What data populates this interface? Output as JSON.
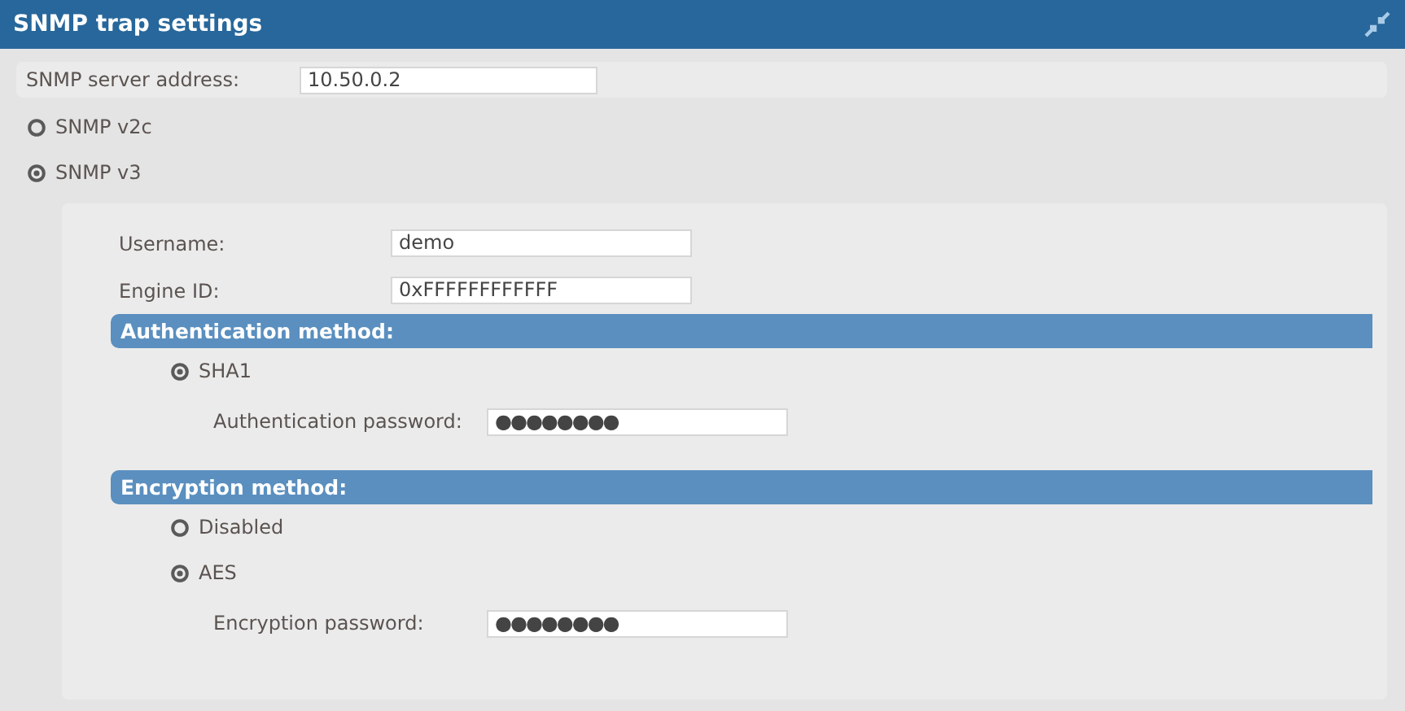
{
  "window": {
    "title": "SNMP trap settings"
  },
  "server": {
    "label": "SNMP server address:",
    "value": "10.50.0.2"
  },
  "versions": [
    {
      "label": "SNMP v2c",
      "selected": false
    },
    {
      "label": "SNMP v3",
      "selected": true
    }
  ],
  "v3": {
    "fields": [
      {
        "label": "Username:",
        "value": "demo"
      },
      {
        "label": "Engine ID:",
        "value": "0xFFFFFFFFFFFF"
      }
    ],
    "sections": [
      {
        "title": "Authentication method:",
        "options": [
          {
            "label": "SHA1",
            "selected": true
          }
        ],
        "password": {
          "label": "Authentication password:",
          "value": "●●●●●●●●"
        }
      },
      {
        "title": "Encryption method:",
        "options": [
          {
            "label": "Disabled",
            "selected": false
          },
          {
            "label": "AES",
            "selected": true
          }
        ],
        "password": {
          "label": "Encryption password:",
          "value": "●●●●●●●●"
        }
      }
    ]
  }
}
